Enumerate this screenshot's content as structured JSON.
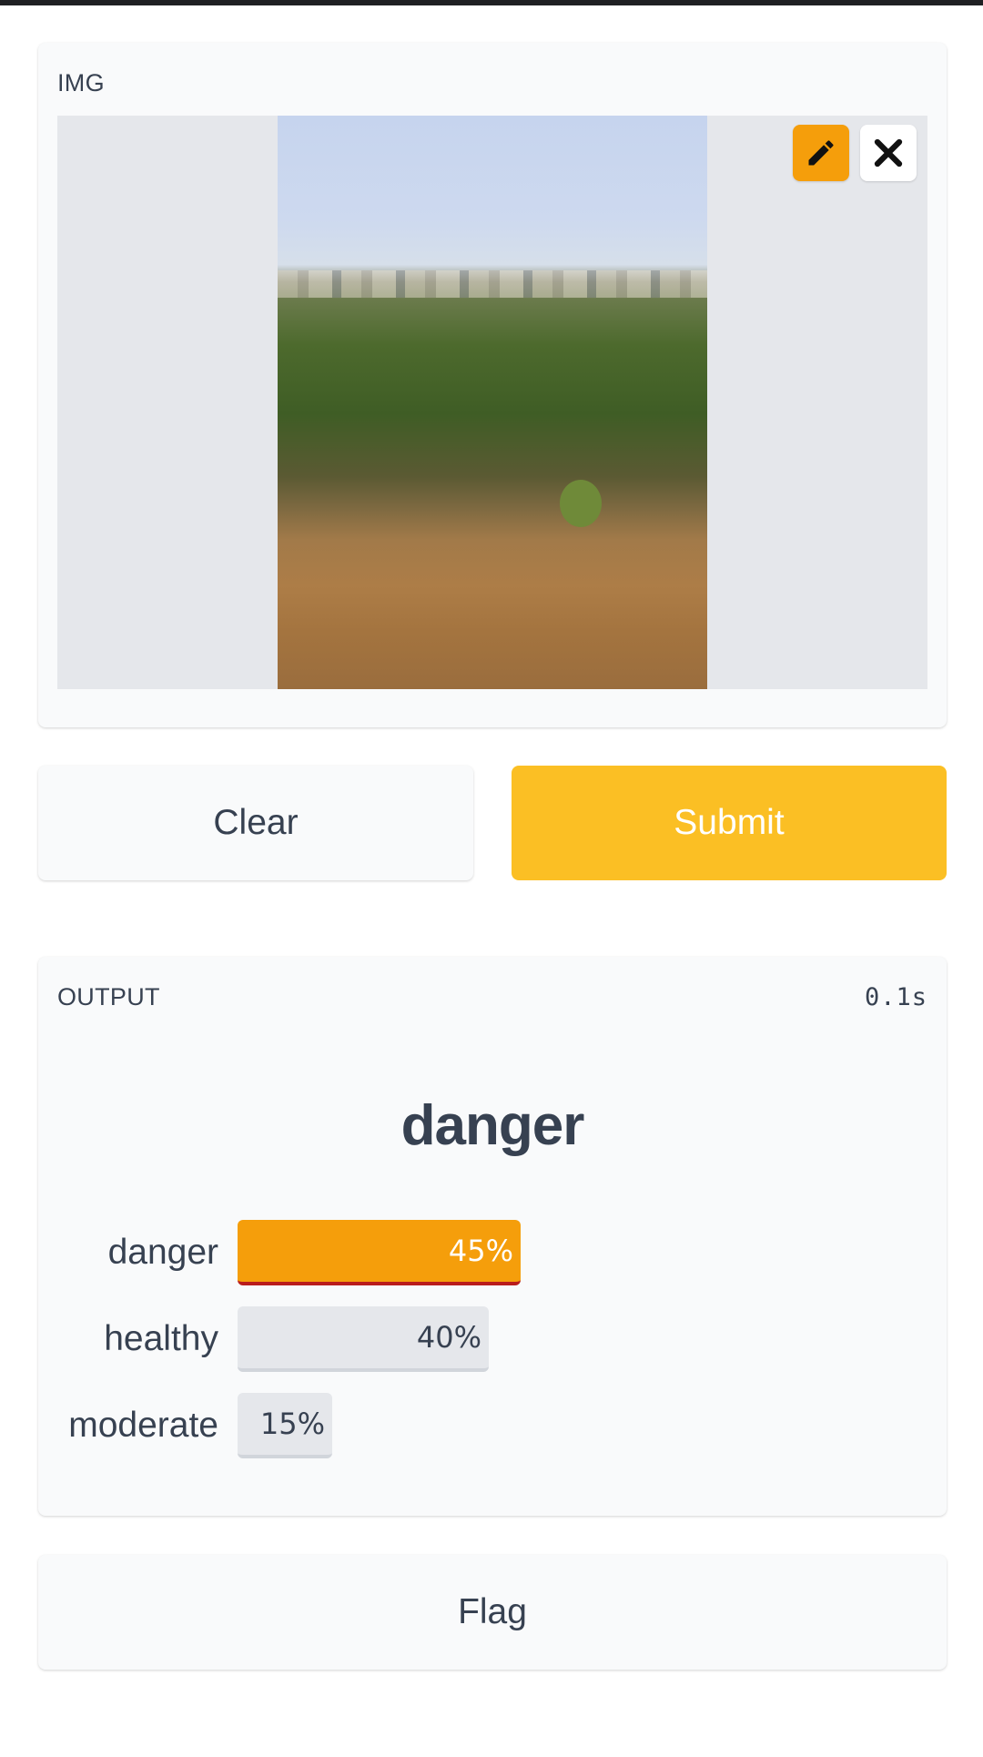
{
  "input": {
    "label": "IMG",
    "image_description_icon": "landscape-photo",
    "edit_icon": "pencil-icon",
    "remove_icon": "close-icon"
  },
  "actions": {
    "clear_label": "Clear",
    "submit_label": "Submit",
    "flag_label": "Flag"
  },
  "output": {
    "label": "OUTPUT",
    "timer": "0.1s",
    "top_label": "danger",
    "confidences": [
      {
        "label": "danger",
        "value": 0.45,
        "display": "45%"
      },
      {
        "label": "healthy",
        "value": 0.4,
        "display": "40%"
      },
      {
        "label": "moderate",
        "value": 0.15,
        "display": "15%"
      }
    ]
  },
  "colors": {
    "accent": "#f59e0b",
    "submit": "#fbbf24",
    "top_bar_underline": "#b91c1c",
    "bar_neutral": "#e5e7eb"
  }
}
